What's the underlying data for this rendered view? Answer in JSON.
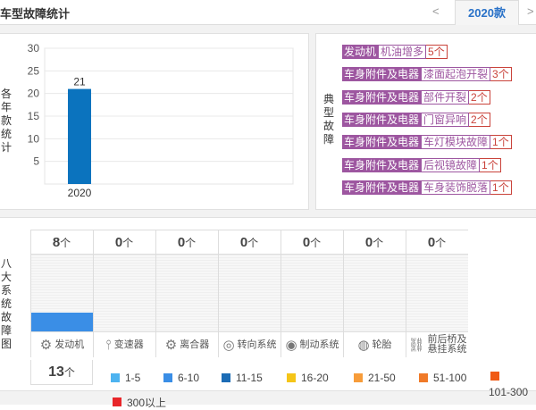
{
  "header": {
    "title": "车型故障统计",
    "prev": "<",
    "year": "2020款",
    "next": ">"
  },
  "year_chart": {
    "side_label": [
      "各",
      "年",
      "款",
      "统",
      "计"
    ],
    "chart_data": {
      "type": "bar",
      "categories": [
        "2020"
      ],
      "values": [
        21
      ],
      "ylim": [
        0,
        30
      ],
      "yticks": [
        5,
        10,
        15,
        20,
        25,
        30
      ],
      "color": "#0b73be"
    }
  },
  "typical_faults": {
    "side_label": [
      "典",
      "型",
      "故",
      "障"
    ],
    "items": [
      {
        "category": "发动机",
        "detail": "机油增多",
        "count": "5个"
      },
      {
        "category": "车身附件及电器",
        "detail": "漆面起泡开裂",
        "count": "3个"
      },
      {
        "category": "车身附件及电器",
        "detail": "部件开裂",
        "count": "2个"
      },
      {
        "category": "车身附件及电器",
        "detail": "门窗异响",
        "count": "2个"
      },
      {
        "category": "车身附件及电器",
        "detail": "车灯模块故障",
        "count": "1个"
      },
      {
        "category": "车身附件及电器",
        "detail": "后视镜故障",
        "count": "1个"
      },
      {
        "category": "车身附件及电器",
        "detail": "车身装饰脱落",
        "count": "1个"
      }
    ]
  },
  "systems": {
    "side_label": [
      "八",
      "大",
      "系",
      "统",
      "故",
      "障",
      "图"
    ],
    "unit": "个",
    "items": [
      {
        "name": "发动机",
        "count": "8",
        "icon": "engine-icon",
        "fill_color": "#3a8ee6"
      },
      {
        "name": "变速器",
        "count": "0",
        "icon": "gear-shift-icon"
      },
      {
        "name": "离合器",
        "count": "0",
        "icon": "clutch-icon"
      },
      {
        "name": "转向系统",
        "count": "0",
        "icon": "steering-wheel-icon"
      },
      {
        "name": "制动系统",
        "count": "0",
        "icon": "brake-icon"
      },
      {
        "name": "轮胎",
        "count": "0",
        "icon": "tire-icon"
      },
      {
        "name": "前后桥及悬挂系统",
        "count": "0",
        "icon": "suspension-icon"
      }
    ],
    "selected_total": "13",
    "selected_total_unit": "个"
  },
  "legend": [
    {
      "label": "1-5",
      "color": "#4db3f0"
    },
    {
      "label": "6-10",
      "color": "#3a8ee6"
    },
    {
      "label": "11-15",
      "color": "#1c6cb5"
    },
    {
      "label": "16-20",
      "color": "#f5c518"
    },
    {
      "label": "21-50",
      "color": "#f79c3a"
    },
    {
      "label": "51-100",
      "color": "#f07a28"
    },
    {
      "label": "101-300",
      "color": "#f05a14"
    },
    {
      "label": "300以上",
      "color": "#e8262a"
    }
  ]
}
